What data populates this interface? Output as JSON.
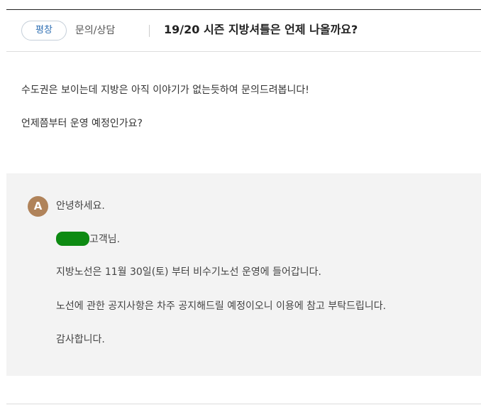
{
  "header": {
    "region_badge": "평창",
    "category": "문의/상담",
    "title": "19/20 시즌 지방셔틀은 언제 나올까요?"
  },
  "question": {
    "lines": [
      "수도권은 보이는데 지방은 아직 이야기가 없는듯하여 문의드려봅니다!",
      "언제쯤부터 운영 예정인가요?"
    ]
  },
  "answer": {
    "avatar_letter": "A",
    "greeting": "안녕하세요.",
    "customer_suffix": "고객님.",
    "lines": [
      "지방노선은 11월 30일(토) 부터 비수기노선 운영에 들어갑니다.",
      "노선에 관한 공지사항은 차주 공지해드릴 예정이오니 이용에 참고 부탁드립니다.",
      "감사합니다."
    ],
    "redaction_color": "#0d8a12",
    "avatar_color": "#b0835a"
  }
}
